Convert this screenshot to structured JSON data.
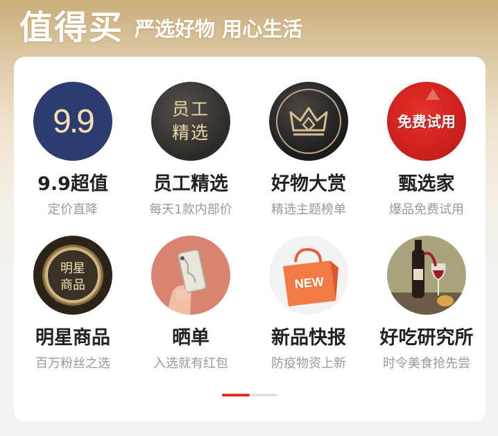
{
  "header": {
    "logo_text": "值得买",
    "slogan": "严选好物 用心生活"
  },
  "tiles": [
    {
      "title": "9.9超值",
      "subtitle": "定价直降",
      "icon": "price-9.9-icon",
      "icon_text": "9.9"
    },
    {
      "title": "员工精选",
      "subtitle": "每天1款内部价",
      "icon": "staff-pick-icon",
      "icon_text_1": "员工",
      "icon_text_2": "精选"
    },
    {
      "title": "好物大赏",
      "subtitle": "精选主题榜单",
      "icon": "crown-icon"
    },
    {
      "title": "甄选家",
      "subtitle": "爆品免费试用",
      "icon": "free-trial-icon",
      "icon_text": "免费试用"
    },
    {
      "title": "明星商品",
      "subtitle": "百万粉丝之选",
      "icon": "star-product-seal-icon",
      "icon_text_1": "明星",
      "icon_text_2": "商品"
    },
    {
      "title": "晒单",
      "subtitle": "入选就有红包",
      "icon": "phone-in-hand-icon"
    },
    {
      "title": "新品快报",
      "subtitle": "防疫物资上新",
      "icon": "new-shopping-bag-icon",
      "icon_text": "NEW"
    },
    {
      "title": "好吃研究所",
      "subtitle": "时令美食抢先尝",
      "icon": "wine-food-icon"
    }
  ],
  "pager": {
    "pages": 2,
    "active_index": 0
  },
  "colors": {
    "accent": "#d9302a",
    "gold": "#c9ad7a",
    "title": "#222222",
    "subtitle": "#999999"
  }
}
